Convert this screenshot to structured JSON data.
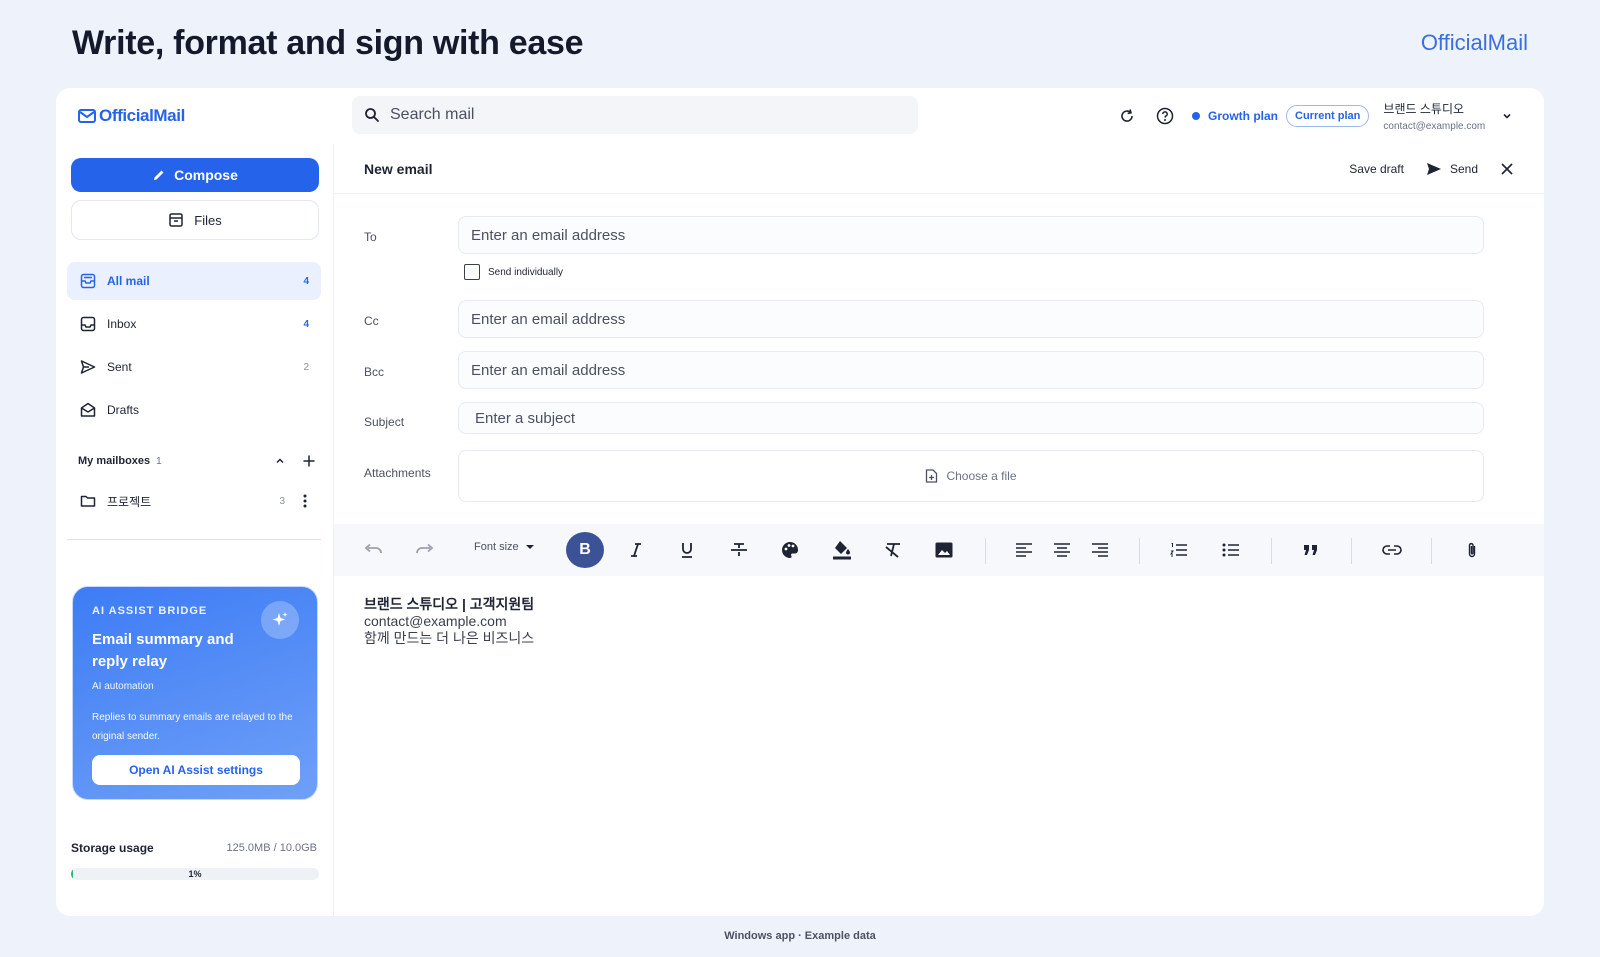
{
  "hero": {
    "title": "Write, format and sign with ease",
    "brand": "OfficialMail"
  },
  "footer": {
    "note": "Windows app · Example data"
  },
  "app": {
    "logo": "OfficialMail",
    "search": {
      "placeholder": "Search mail"
    },
    "topbar": {
      "plan_label": "Growth plan",
      "plan_badge": "Current plan",
      "user_name": "브랜드 스튜디오",
      "user_email": "contact@example.com"
    },
    "sidebar": {
      "compose_label": "Compose",
      "files_label": "Files",
      "items": [
        {
          "label": "All mail",
          "count": "4",
          "icon": "all-mail-icon"
        },
        {
          "label": "Inbox",
          "count": "4",
          "icon": "inbox-icon"
        },
        {
          "label": "Sent",
          "count": "2",
          "icon": "send-icon"
        },
        {
          "label": "Drafts",
          "count": "",
          "icon": "drafts-icon"
        }
      ],
      "mailboxes": {
        "label": "My mailboxes",
        "count": "1",
        "items": [
          {
            "label": "프로젝트",
            "count": "3",
            "icon": "folder-icon"
          }
        ]
      },
      "ai_card": {
        "eyebrow": "AI ASSIST BRIDGE",
        "title": "Email summary and reply relay",
        "subtitle": "AI automation",
        "description": "Replies to summary emails are relayed to the original sender.",
        "button_label": "Open AI Assist settings"
      },
      "storage": {
        "label": "Storage usage",
        "value": "125.0MB / 10.0GB",
        "percent_label": "1%",
        "percent": 1
      }
    },
    "compose": {
      "title": "New email",
      "save_draft": "Save draft",
      "send": "Send",
      "fields": {
        "to_label": "To",
        "to_placeholder": "Enter an email address",
        "send_individually": "Send individually",
        "cc_label": "Cc",
        "cc_placeholder": "Enter an email address",
        "bcc_label": "Bcc",
        "bcc_placeholder": "Enter an email address",
        "subject_label": "Subject",
        "subject_placeholder": "Enter a subject",
        "attachments_label": "Attachments",
        "choose_file": "Choose a file"
      },
      "toolbar": {
        "font_size": "Font size",
        "bold": "B"
      },
      "signature": {
        "line1": "브랜드 스튜디오 | 고객지원팀",
        "line2": "contact@example.com",
        "line3": "함께 만드는 더 나은 비즈니스"
      }
    },
    "colors": {
      "accent": "#2563eb",
      "bold_active": "#3b5296",
      "storage_fill": "#2eb872"
    }
  }
}
